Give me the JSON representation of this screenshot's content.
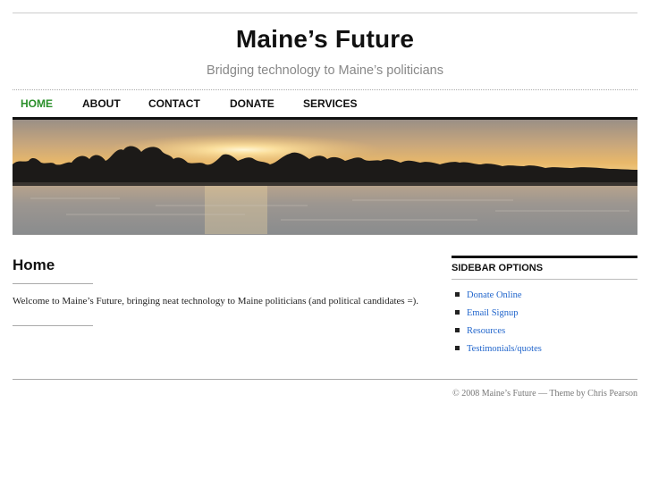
{
  "header": {
    "title": "Maine’s Future",
    "tagline": "Bridging technology to Maine’s politicians"
  },
  "nav": {
    "items": [
      {
        "label": "HOME",
        "active": true
      },
      {
        "label": "ABOUT",
        "active": false
      },
      {
        "label": "CONTACT",
        "active": false
      },
      {
        "label": "DONATE",
        "active": false
      },
      {
        "label": "SERVICES",
        "active": false
      }
    ]
  },
  "banner": {
    "alt": "sunset over lake with tree line"
  },
  "main": {
    "heading": "Home",
    "body": "Welcome to Maine’s Future, bringing neat technology to Maine politicians (and political candidates =)."
  },
  "sidebar": {
    "heading": "SIDEBAR OPTIONS",
    "items": [
      {
        "label": "Donate Online"
      },
      {
        "label": "Email Signup"
      },
      {
        "label": "Resources"
      },
      {
        "label": "Testimonials/quotes"
      }
    ]
  },
  "footer": {
    "text": "© 2008 Maine’s Future — Theme by Chris Pearson"
  },
  "colors": {
    "active_nav": "#2a8f2a",
    "link": "#2266cc"
  }
}
